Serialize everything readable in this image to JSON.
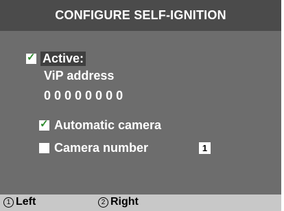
{
  "title": "CONFIGURE SELF-IGNITION",
  "active": {
    "label": "Active:",
    "checked": true
  },
  "vip": {
    "label": "ViP address",
    "value": "0 0 0 0 0 0 0 0"
  },
  "automatic_camera": {
    "label": "Automatic camera",
    "checked": true
  },
  "camera_number": {
    "label": "Camera number",
    "checked": false,
    "value": "1"
  },
  "footer": {
    "left": {
      "key": "1",
      "label": "Left"
    },
    "right": {
      "key": "2",
      "label": "Right"
    }
  },
  "colors": {
    "title_bg": "#4b4b4b",
    "panel_bg": "#6d6d6d",
    "footer_bg": "#c8c8c8",
    "check": "#2e8b2e"
  }
}
